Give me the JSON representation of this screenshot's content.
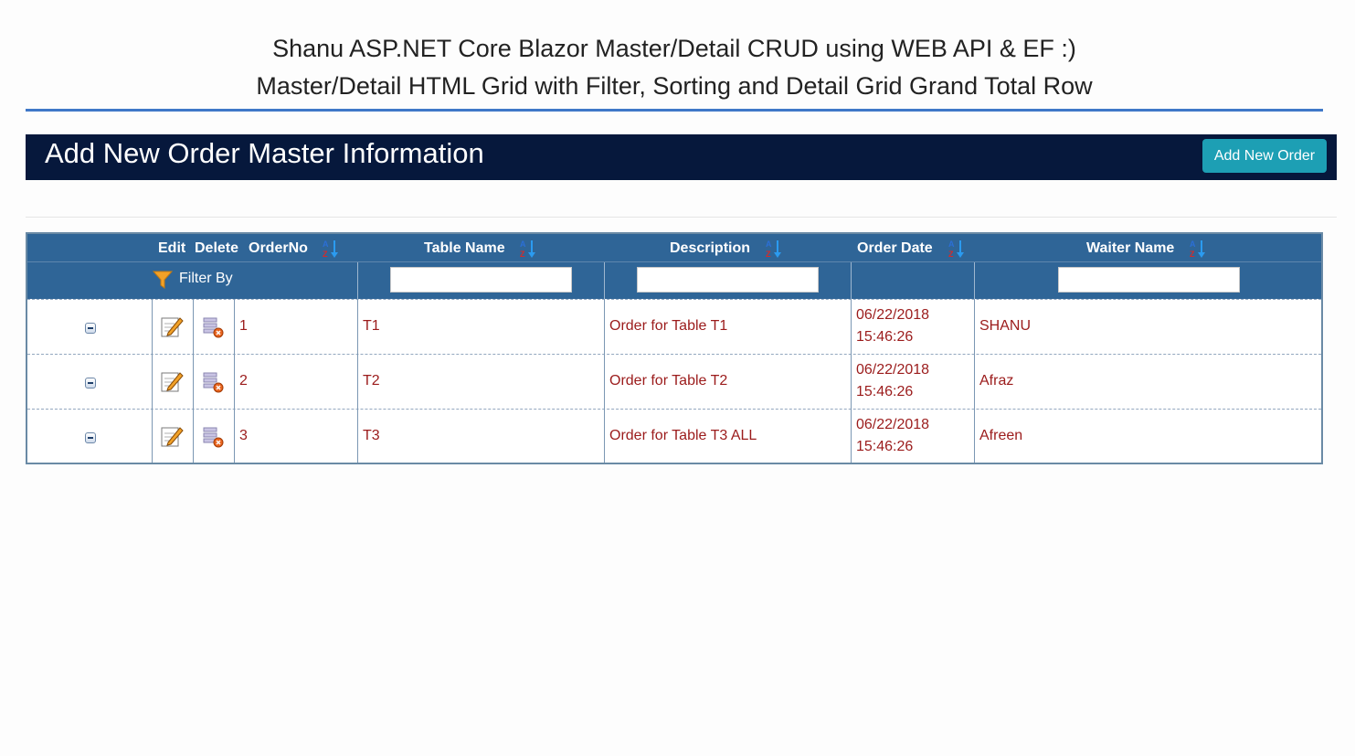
{
  "page": {
    "title_line1": "Shanu ASP.NET Core Blazor Master/Detail CRUD using WEB API & EF :)",
    "title_line2": "Master/Detail HTML Grid with Filter, Sorting and Detail Grid Grand Total Row"
  },
  "banner": {
    "title": "Add New Order Master Information",
    "add_button_label": "Add New Order"
  },
  "grid": {
    "headers": {
      "edit": "Edit",
      "delete": "Delete",
      "order_no": "OrderNo",
      "table_name": "Table Name",
      "description": "Description",
      "order_date": "Order Date",
      "waiter_name": "Waiter Name"
    },
    "filter_label": "Filter By",
    "filters": {
      "table_name": "",
      "description": "",
      "waiter_name": ""
    },
    "rows": [
      {
        "order_no": "1",
        "table_name": "T1",
        "description": "Order for Table T1",
        "order_date_day": "06/22/2018",
        "order_date_time": "15:46:26",
        "waiter_name": "SHANU"
      },
      {
        "order_no": "2",
        "table_name": "T2",
        "description": "Order for Table T2",
        "order_date_day": "06/22/2018",
        "order_date_time": "15:46:26",
        "waiter_name": "Afraz"
      },
      {
        "order_no": "3",
        "table_name": "T3",
        "description": "Order for Table T3 ALL",
        "order_date_day": "06/22/2018",
        "order_date_time": "15:46:26",
        "waiter_name": "Afreen"
      }
    ]
  },
  "colors": {
    "banner": "#06183c",
    "header": "#2f6597",
    "add_button": "#1d9fb4",
    "cell_text": "#9b1b1b",
    "title_rule": "#3f78c8"
  },
  "icons": {
    "sort": "sort-az-icon",
    "filter": "funnel-icon",
    "edit": "pencil-note-icon",
    "delete": "delete-record-icon",
    "collapse": "minus-box-icon"
  }
}
